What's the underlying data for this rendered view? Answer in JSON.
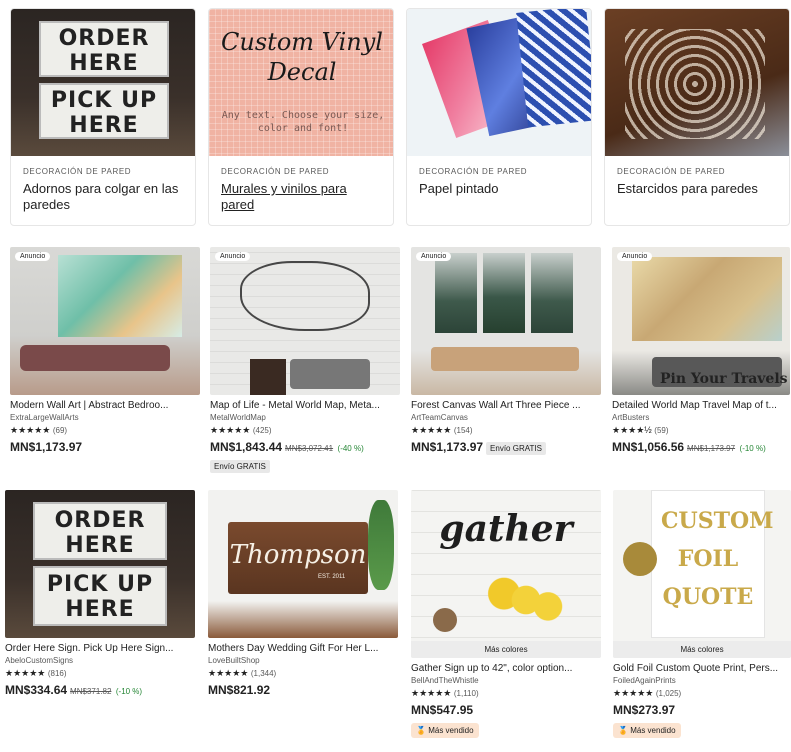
{
  "categories": [
    {
      "kicker": "DECORACIÓN DE PARED",
      "title": "Adornos para colgar en las paredes",
      "sign1": "ORDER HERE",
      "sign2": "PICK UP HERE"
    },
    {
      "kicker": "DECORACIÓN DE PARED",
      "title": "Murales y vinilos para pared",
      "deco_script": "Custom Vinyl Decal",
      "deco_mono": "Any text. Choose your size, color and font!"
    },
    {
      "kicker": "DECORACIÓN DE PARED",
      "title": "Papel pintado"
    },
    {
      "kicker": "DECORACIÓN DE PARED",
      "title": "Estarcidos para paredes"
    }
  ],
  "products": [
    {
      "ad": "Anuncio",
      "name": "Modern Wall Art | Abstract Bedroo...",
      "shop": "ExtraLargeWallArts",
      "stars": "★★★★★",
      "reviews": "(69)",
      "price": "MN$1,173.97"
    },
    {
      "ad": "Anuncio",
      "name": "Map of Life - Metal World Map, Meta...",
      "shop": "MetalWorldMap",
      "stars": "★★★★★",
      "reviews": "(425)",
      "price": "MN$1,843.44",
      "old_price": "MN$3,072.41",
      "discount": "(-40 %)",
      "shipping": "Envío GRATIS"
    },
    {
      "ad": "Anuncio",
      "name": "Forest Canvas Wall Art Three Piece ...",
      "shop": "ArtTeamCanvas",
      "stars": "★★★★★",
      "reviews": "(154)",
      "price": "MN$1,173.97",
      "shipping": "Envío GRATIS"
    },
    {
      "ad": "Anuncio",
      "name": "Detailed World Map Travel Map of t...",
      "shop": "ArtBusters",
      "stars": "★★★★½",
      "reviews": "(59)",
      "price": "MN$1,056.56",
      "old_price": "MN$1,173.97",
      "discount": "(-10 %)",
      "overlay": "Pin Your Travels"
    },
    {
      "name": "Order Here Sign. Pick Up Here Sign...",
      "shop": "AbeloCustomSigns",
      "stars": "★★★★★",
      "reviews": "(816)",
      "price": "MN$334.64",
      "old_price": "MN$371.82",
      "discount": "(-10 %)",
      "sign1": "ORDER HERE",
      "sign2": "PICK UP HERE"
    },
    {
      "name": "Mothers Day Wedding Gift For Her L...",
      "shop": "LoveBuiltShop",
      "stars": "★★★★★",
      "reviews": "(1,344)",
      "price": "MN$821.92",
      "overlay": "Thompson",
      "overlay_small": "EST. 2011"
    },
    {
      "name": "Gather Sign up to 42\", color option...",
      "shop": "BellAndTheWhistle",
      "stars": "★★★★★",
      "reviews": "(1,110)",
      "price": "MN$547.95",
      "colors": "Más colores",
      "badge": "Más vendido",
      "overlay": "gather"
    },
    {
      "name": "Gold Foil Custom Quote Print, Pers...",
      "shop": "FoiledAgainPrints",
      "stars": "★★★★★",
      "reviews": "(1,025)",
      "price": "MN$273.97",
      "colors": "Más colores",
      "badge": "Más vendido",
      "overlay": "CUSTOM FOIL QUOTE"
    }
  ],
  "colors": {
    "discount": "#258635",
    "badge_bg": "#fbe3d0",
    "shipping_bg": "#e8e8e8"
  }
}
